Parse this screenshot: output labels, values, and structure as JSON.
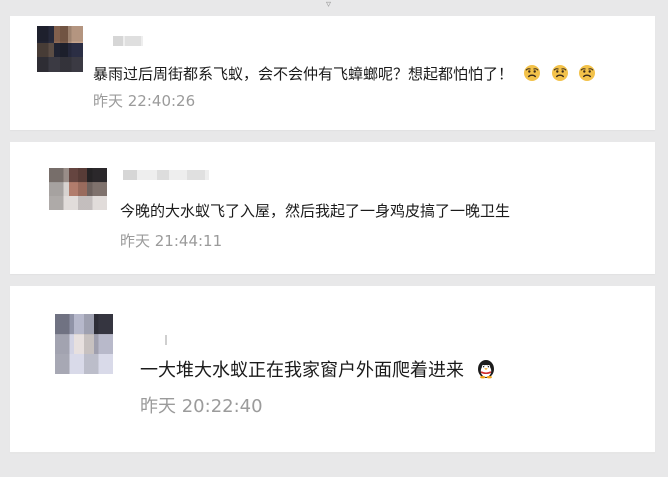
{
  "comments": [
    {
      "text": "暴雨过后周街都系飞蚁，会不会仲有飞蟑螂呢？想起都怕怕了！",
      "time": "昨天 22:40:26",
      "emojis": [
        "scared-face",
        "scared-face",
        "scared-face"
      ]
    },
    {
      "text": "今晚的大水蚁飞了入屋，然后我起了一身鸡皮搞了一晚卫生",
      "time": "昨天 21:44:11",
      "emojis": []
    },
    {
      "text": "一大堆大水蚁正在我家窗户外面爬着进来",
      "time": "昨天 20:22:40",
      "emojis": [
        "penguin"
      ]
    }
  ]
}
